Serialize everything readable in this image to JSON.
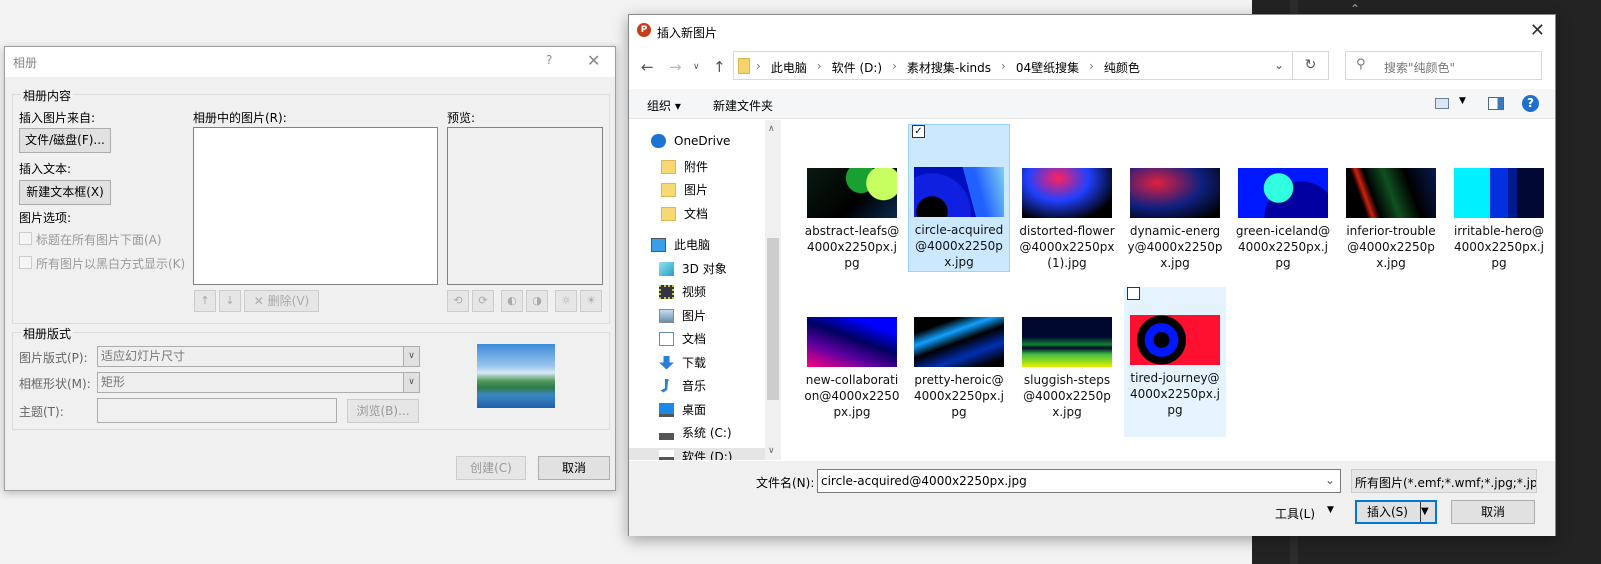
{
  "album": {
    "title": "相册",
    "help": "?",
    "close": "✕",
    "content_group": "相册内容",
    "insert_from": "插入图片来自:",
    "file_btn": "文件/磁盘(F)...",
    "insert_text": "插入文本:",
    "textbox_btn": "新建文本框(X)",
    "pic_options": "图片选项:",
    "opt_caption": "标题在所有图片下面(A)",
    "opt_bw": "所有图片以黑白方式显示(K)",
    "pics_label": "相册中的图片(R):",
    "preview_label": "预览:",
    "up": "↑",
    "down": "↓",
    "delete_btn": "✕ 删除(V)",
    "layout_group": "相册版式",
    "pic_layout_label": "图片版式(P):",
    "pic_layout_value": "适应幻灯片尺寸",
    "frame_label": "相框形状(M):",
    "frame_value": "矩形",
    "theme_label": "主题(T):",
    "browse_btn": "浏览(B)...",
    "create_btn": "创建(C)",
    "cancel_btn": "取消"
  },
  "file_dialog": {
    "title": "插入新图片",
    "app_icon": "P",
    "close": "✕",
    "breadcrumbs": [
      "此电脑",
      "软件 (D:)",
      "素材搜集-kinds",
      "04壁纸搜集",
      "纯颜色"
    ],
    "search_placeholder": "搜索\"纯颜色\"",
    "organize": "组织 ▾",
    "new_folder": "新建文件夹",
    "help": "?",
    "nav": [
      {
        "label": "OneDrive",
        "icon": "onedrive-icon"
      },
      {
        "label": "附件",
        "icon": "folder-icon"
      },
      {
        "label": "图片",
        "icon": "folder-icon"
      },
      {
        "label": "文档",
        "icon": "folder-icon"
      },
      {
        "label": "此电脑",
        "icon": "computer-icon"
      },
      {
        "label": "3D 对象",
        "icon": "3d-objects-icon"
      },
      {
        "label": "视频",
        "icon": "video-icon"
      },
      {
        "label": "图片",
        "icon": "pictures-icon"
      },
      {
        "label": "文档",
        "icon": "documents-icon"
      },
      {
        "label": "下载",
        "icon": "download-icon"
      },
      {
        "label": "音乐",
        "icon": "music-icon"
      },
      {
        "label": "桌面",
        "icon": "desktop-icon"
      },
      {
        "label": "系统 (C:)",
        "icon": "drive-icon"
      },
      {
        "label": "软件 (D:)",
        "icon": "drive-icon"
      }
    ],
    "files": [
      {
        "name": "abstract-leafs@4000x2250px.jpg",
        "selected": false,
        "checkbox": false
      },
      {
        "name": "circle-acquired@4000x2250px.jpg",
        "selected": true,
        "checkbox": true
      },
      {
        "name": "distorted-flower@4000x2250px (1).jpg",
        "selected": false,
        "checkbox": false
      },
      {
        "name": "dynamic-energy@4000x2250px.jpg",
        "selected": false,
        "checkbox": false
      },
      {
        "name": "green-iceland@4000x2250px.jpg",
        "selected": false,
        "checkbox": false
      },
      {
        "name": "inferior-trouble@4000x2250px.jpg",
        "selected": false,
        "checkbox": false
      },
      {
        "name": "irritable-hero@4000x2250px.jpg",
        "selected": false,
        "checkbox": false
      },
      {
        "name": "new-collaboration@4000x2250px.jpg",
        "selected": false,
        "checkbox": false
      },
      {
        "name": "pretty-heroic@4000x2250px.jpg",
        "selected": false,
        "checkbox": false
      },
      {
        "name": "sluggish-steps@4000x2250px.jpg",
        "selected": false,
        "checkbox": false
      },
      {
        "name": "tired-journey@4000x2250px.jpg",
        "selected": false,
        "checkbox": false,
        "hover": true
      }
    ],
    "filename_label": "文件名(N):",
    "filename_value": "circle-acquired@4000x2250px.jpg",
    "filetype": "所有图片(*.emf;*.wmf;*.jpg;*.jp",
    "tools": "工具(L)",
    "insert_btn": "插入(S)",
    "cancel_btn": "取消"
  }
}
